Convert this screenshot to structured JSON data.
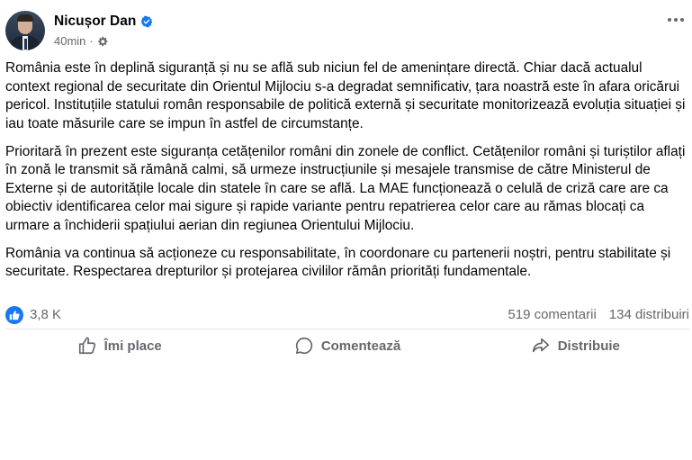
{
  "post": {
    "author": "Nicușor Dan",
    "time": "40min",
    "separator": "·",
    "paragraphs": [
      "România este în deplină siguranță și nu se află sub niciun fel de amenințare directă. Chiar dacă actualul context regional de securitate din Orientul Mijlociu s-a degradat semnificativ, țara noastră este în afara oricărui pericol. Instituțiile statului român responsabile de politică externă și securitate monitorizează evoluția situației și iau toate măsurile care se impun în astfel de circumstanțe.",
      "Prioritară în prezent este siguranța cetățenilor români din zonele de conflict. Cetățenilor români și turiștilor aflați în zonă le transmit să rămână calmi, să urmeze instrucțiunile și mesajele transmise de către Ministerul de Externe și de autoritățile locale din statele în care se află. La MAE funcționează o celulă de criză care are ca obiectiv identificarea celor mai sigure și rapide variante pentru repatrierea celor care au rămas blocați ca urmare a închiderii spațiului aerian din regiunea Orientului Mijlociu.",
      "România va continua să acționeze cu responsabilitate, în coordonare cu partenerii noștri, pentru stabilitate și securitate. Respectarea drepturilor și protejarea civililor rămân priorități fundamentale."
    ]
  },
  "stats": {
    "reactions": "3,8 K",
    "comments": "519 comentarii",
    "shares": "134 distribuiri"
  },
  "actions": {
    "like": "Îmi place",
    "comment": "Comentează",
    "share": "Distribuie"
  },
  "colors": {
    "accent": "#1877f2",
    "secondary_text": "#65676b",
    "text": "#050505",
    "divider": "#e4e6eb"
  },
  "icons": {
    "verified": "verified-badge-icon",
    "audience": "gear-icon",
    "more": "more-options-icon",
    "like_badge": "thumbs-up-icon",
    "like": "thumbs-up-outline-icon",
    "comment": "comment-bubble-icon",
    "share": "share-arrow-icon"
  }
}
